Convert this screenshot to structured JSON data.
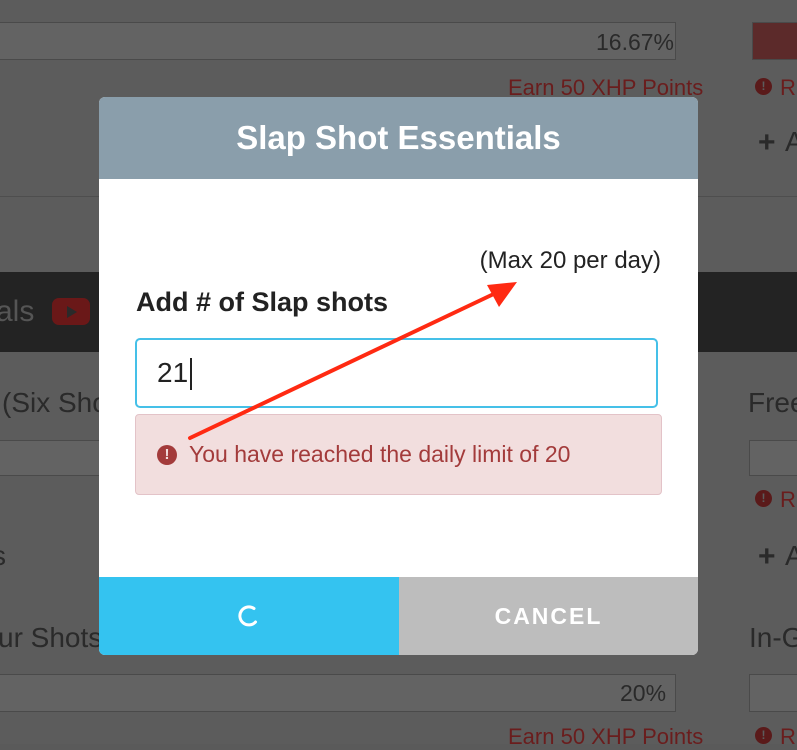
{
  "background": {
    "percent_top": "16.67%",
    "earn_top": "Earn 50 XHP Points",
    "section_partial": "als",
    "row_left_1": "(Six Shot",
    "row_right_1": "Free",
    "row_left_2": "ur Shots",
    "row_right_2": "In-Ga",
    "percent_bottom": "20%",
    "earn_bottom": "Earn 50 XHP Points",
    "rl_label": "RI",
    "plus_a": "A",
    "s_partial": "s"
  },
  "modal": {
    "title": "Slap Shot Essentials",
    "max_note": "(Max 20 per day)",
    "field_label": "Add # of Slap shots",
    "input_value": "21",
    "error_icon_glyph": "!",
    "error_message": "You have reached the daily limit of 20",
    "cancel_label": "CANCEL"
  },
  "colors": {
    "header": "#8a9eab",
    "submit": "#34c3f0",
    "cancel": "#bdbdbd",
    "error_text": "#a33b3b",
    "annotation": "#ff2a12"
  }
}
